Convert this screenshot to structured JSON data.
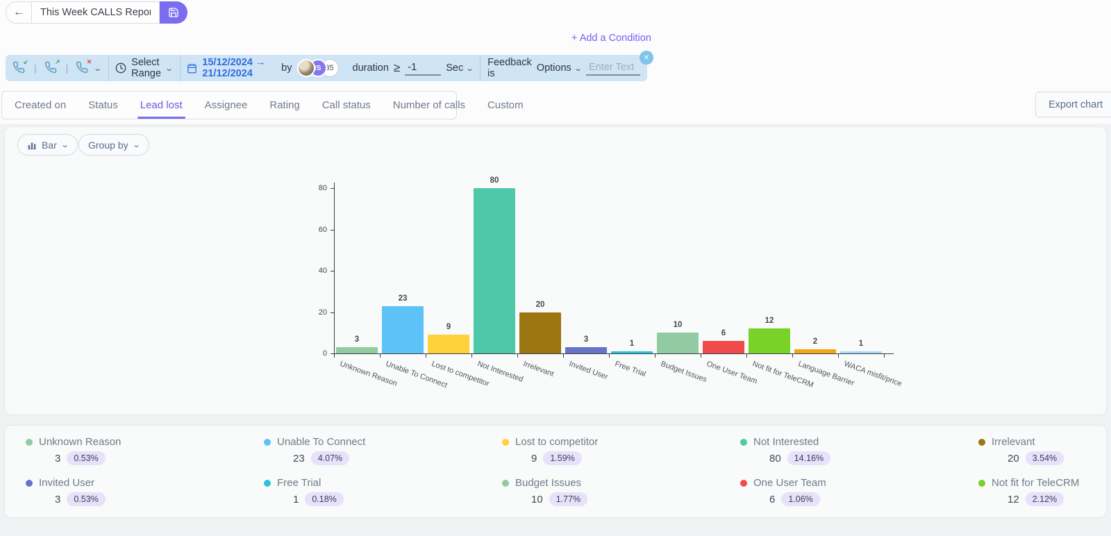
{
  "header": {
    "title_value": "This Week CALLS Reports",
    "add_condition_label": "+ Add a Condition"
  },
  "filter_bar": {
    "select_range_label": "Select Range",
    "date_range": "15/12/2024 → 21/12/2024",
    "by_label": "by",
    "avatar_initials": "IS",
    "avatar_count": "35",
    "duration_label": "duration",
    "duration_operator": "≥",
    "duration_value": "-1",
    "duration_unit": "Sec",
    "feedback_label": "Feedback is",
    "options_label": "Options",
    "text_placeholder": "Enter Text"
  },
  "tabs": {
    "items": [
      "Created on",
      "Status",
      "Lead lost",
      "Assignee",
      "Rating",
      "Call status",
      "Number of calls",
      "Custom"
    ],
    "active_index": 2,
    "export_label": "Export chart"
  },
  "chart_controls": {
    "chart_type_label": "Bar",
    "group_by_label": "Group by"
  },
  "chart_data": {
    "type": "bar",
    "title": "",
    "xlabel": "",
    "ylabel": "",
    "categories": [
      "Unknown Reason",
      "Unable To Connect",
      "Lost to competitor",
      "Not Interested",
      "Irrelevant",
      "Invited User",
      "Free Trial",
      "Budget Issues",
      "One User Team",
      "Not fit for TeleCRM",
      "Language Barrier",
      "WACA misfit/price"
    ],
    "values": [
      3,
      23,
      9,
      80,
      20,
      3,
      1,
      10,
      6,
      12,
      2,
      1
    ],
    "colors": [
      "#92cba2",
      "#5cc2f8",
      "#fdd23a",
      "#4dc9a9",
      "#9b7510",
      "#6673c9",
      "#29c3d8",
      "#92cba2",
      "#f04a4a",
      "#79d227",
      "#f0a817",
      "#a6dbf8"
    ],
    "yticks": [
      0,
      20,
      40,
      60,
      80
    ],
    "ylim": [
      0,
      80
    ],
    "grid": false,
    "legend_position": "bottom-panel"
  },
  "legend": {
    "items": [
      {
        "label": "Unknown Reason",
        "count": "3",
        "percent": "0.53%",
        "color": "#92cba2"
      },
      {
        "label": "Unable To Connect",
        "count": "23",
        "percent": "4.07%",
        "color": "#5cc2f8"
      },
      {
        "label": "Lost to competitor",
        "count": "9",
        "percent": "1.59%",
        "color": "#fdd23a"
      },
      {
        "label": "Not Interested",
        "count": "80",
        "percent": "14.16%",
        "color": "#4dc9a9"
      },
      {
        "label": "Irrelevant",
        "count": "20",
        "percent": "3.54%",
        "color": "#9b7510"
      },
      {
        "label": "Invited User",
        "count": "3",
        "percent": "0.53%",
        "color": "#6673c9"
      },
      {
        "label": "Free Trial",
        "count": "1",
        "percent": "0.18%",
        "color": "#29c3d8"
      },
      {
        "label": "Budget Issues",
        "count": "10",
        "percent": "1.77%",
        "color": "#92cba2"
      },
      {
        "label": "One User Team",
        "count": "6",
        "percent": "1.06%",
        "color": "#f04a4a"
      },
      {
        "label": "Not fit for TeleCRM",
        "count": "12",
        "percent": "2.12%",
        "color": "#79d227"
      }
    ]
  },
  "colors": {
    "accent_purple": "#7b6cf0",
    "filter_bar_bg": "#cfe4f5",
    "date_blue": "#2e6be0",
    "badge_bg": "#e7e1fa",
    "axis": "#3a3a40"
  }
}
